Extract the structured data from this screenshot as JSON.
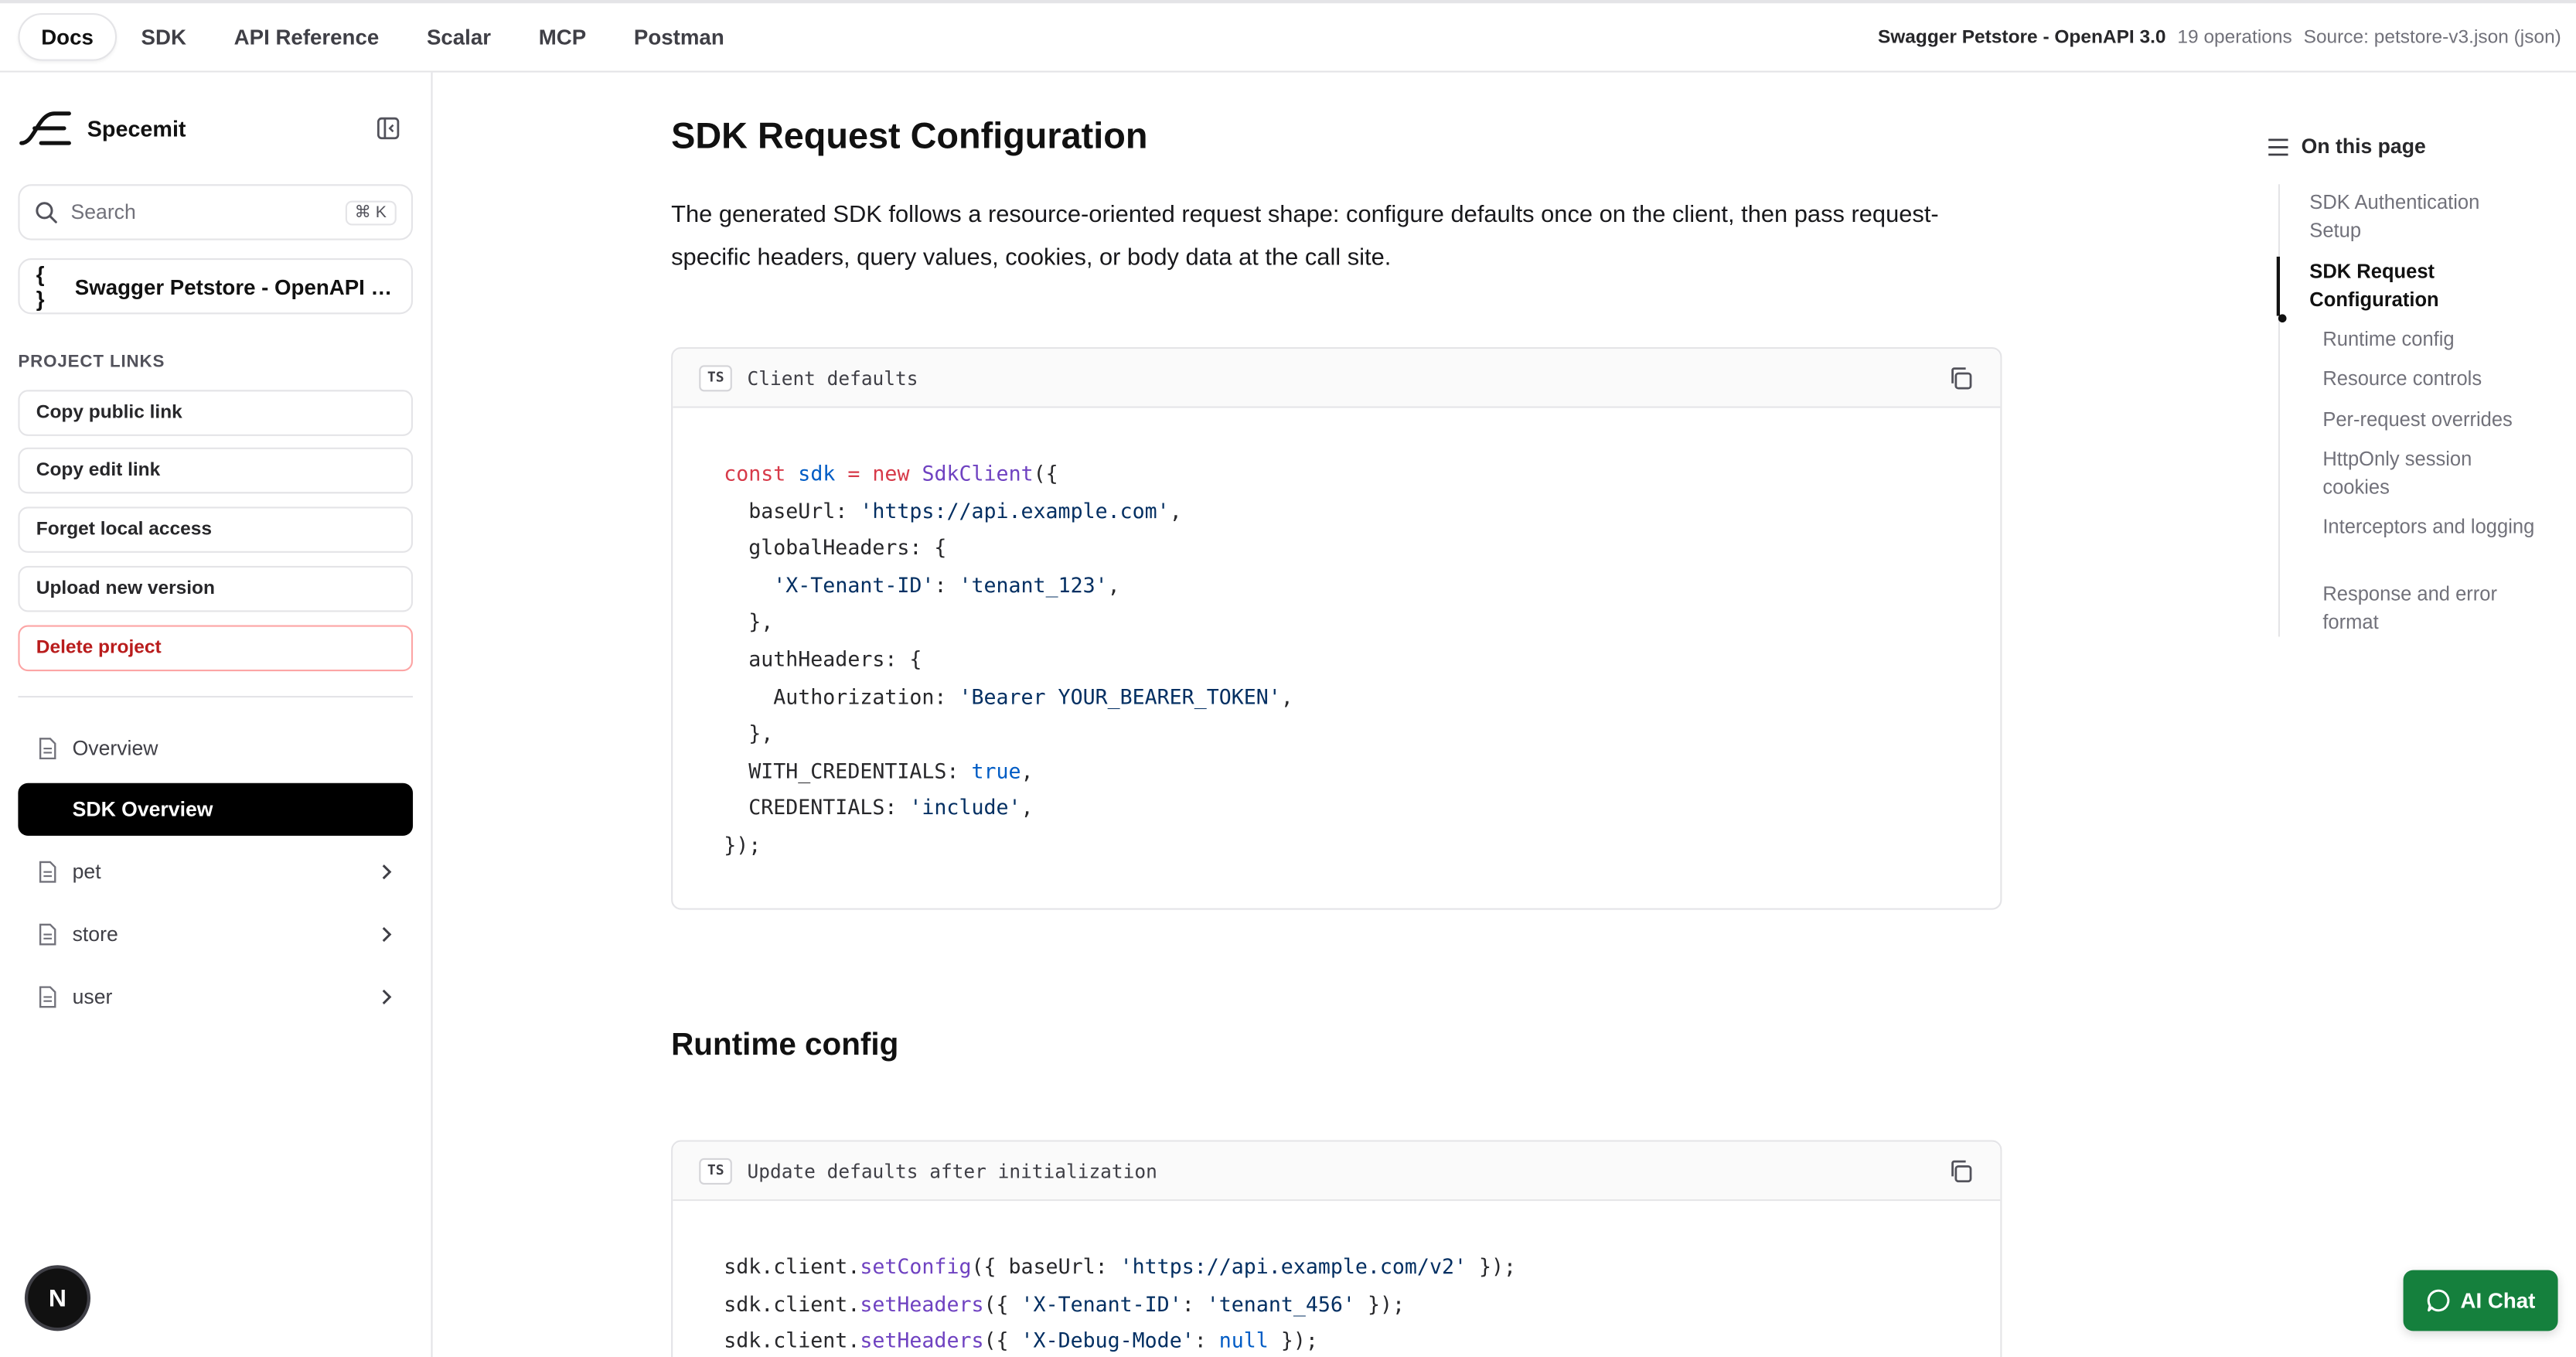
{
  "topbar": {
    "tabs": [
      {
        "label": "Docs",
        "active": true
      },
      {
        "label": "SDK"
      },
      {
        "label": "API Reference"
      },
      {
        "label": "Scalar"
      },
      {
        "label": "MCP"
      },
      {
        "label": "Postman"
      }
    ],
    "spec_title": "Swagger Petstore - OpenAPI 3.0",
    "operations": "19 operations",
    "source": "Source: petstore-v3.json (json)"
  },
  "sidebar": {
    "brand": "Specemit",
    "search_label": "Search",
    "search_shortcut": "⌘ K",
    "spec_selector": "Swagger Petstore - OpenAPI 3...",
    "links_heading": "PROJECT LINKS",
    "links": [
      {
        "label": "Copy public link"
      },
      {
        "label": "Copy edit link"
      },
      {
        "label": "Forget local access"
      },
      {
        "label": "Upload new version"
      },
      {
        "label": "Delete project"
      }
    ],
    "nav": [
      {
        "label": "Overview"
      },
      {
        "label": "SDK Overview",
        "active": true
      },
      {
        "label": "pet"
      },
      {
        "label": "store"
      },
      {
        "label": "user"
      }
    ],
    "badge": "N"
  },
  "main": {
    "title": "SDK Request Configuration",
    "intro": "The generated SDK follows a resource-oriented request shape: configure defaults once on the client, then pass request-specific headers, query values, cookies, or body data at the call site.",
    "code1": {
      "lang": "TS",
      "title": "Client defaults"
    },
    "runtime_title": "Runtime config",
    "code2": {
      "lang": "TS",
      "title": "Update defaults after initialization"
    }
  },
  "toc": {
    "heading": "On this page",
    "items": [
      {
        "label": "SDK Authentication Setup"
      },
      {
        "label": "SDK Request Configuration",
        "active": true
      },
      {
        "label": "Runtime config"
      },
      {
        "label": "Resource controls"
      },
      {
        "label": "Per-request overrides"
      },
      {
        "label": "HttpOnly session cookies"
      },
      {
        "label": "Interceptors and logging"
      },
      {
        "label": "Response and error format"
      }
    ]
  },
  "ai_chat_label": "AI Chat",
  "colors": {
    "accent_green": "#15803d",
    "danger": "#b91c1c",
    "active_nav": "#000000"
  }
}
